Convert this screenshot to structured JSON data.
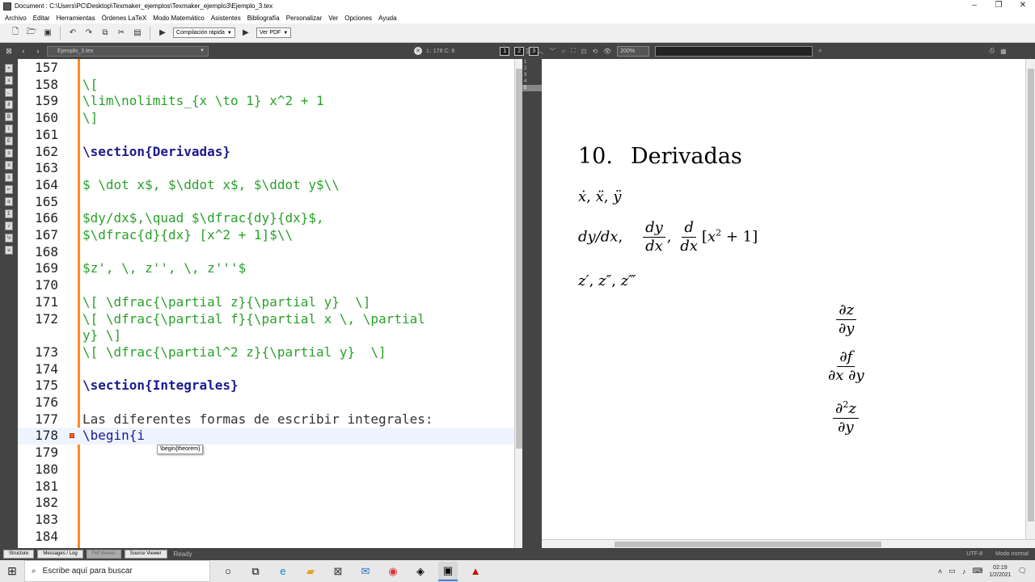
{
  "window": {
    "title": "Document : C:\\Users\\PC\\Desktop\\Texmaker_ejemplos\\Texmaker_ejemplo3\\Ejemplo_3.tex"
  },
  "menu": [
    "Archivo",
    "Editar",
    "Herramientas",
    "Órdenes LaTeX",
    "Modo Matemático",
    "Asistentes",
    "Bibliografía",
    "Personalizar",
    "Ver",
    "Opciones",
    "Ayuda"
  ],
  "toolbar": {
    "compile_label": "Compilación rápida",
    "view_label": "Ver PDF"
  },
  "tabbar": {
    "file_name": "Ejemplo_3.tex",
    "position": "L: 178 C: 8",
    "structure_buttons": [
      "1",
      "2",
      "3"
    ],
    "zoom": "200%"
  },
  "editor": {
    "lines": [
      {
        "num": "157",
        "text": "",
        "style": "green"
      },
      {
        "num": "158",
        "text": "\\[",
        "style": "green"
      },
      {
        "num": "159",
        "text": "\\lim\\nolimits_{x \\to 1} x^2 + 1",
        "style": "green"
      },
      {
        "num": "160",
        "text": "\\]",
        "style": "green"
      },
      {
        "num": "161",
        "text": "",
        "style": "green"
      },
      {
        "num": "162",
        "text": "\\section{Derivadas}",
        "style": "blue"
      },
      {
        "num": "163",
        "text": "",
        "style": "green"
      },
      {
        "num": "164",
        "text": "$ \\dot x$, $\\ddot x$, $\\ddot y$\\\\",
        "style": "green"
      },
      {
        "num": "165",
        "text": "",
        "style": "green"
      },
      {
        "num": "166",
        "text": "$dy/dx$,\\quad $\\dfrac{dy}{dx}$,",
        "style": "green"
      },
      {
        "num": "167",
        "text": "$\\dfrac{d}{dx} [x^2 + 1]$\\\\",
        "style": "green"
      },
      {
        "num": "168",
        "text": "",
        "style": "green"
      },
      {
        "num": "169",
        "text": "$z', \\, z'', \\, z'''$",
        "style": "green"
      },
      {
        "num": "170",
        "text": "",
        "style": "green"
      },
      {
        "num": "171",
        "text": "\\[ \\dfrac{\\partial z}{\\partial y}  \\]",
        "style": "green"
      },
      {
        "num": "172",
        "text": "\\[ \\dfrac{\\partial f}{\\partial x \\, \\partial",
        "style": "green"
      },
      {
        "num": "",
        "text": "y} \\]",
        "style": "green"
      },
      {
        "num": "173",
        "text": "\\[ \\dfrac{\\partial^2 z}{\\partial y}  \\]",
        "style": "green"
      },
      {
        "num": "174",
        "text": "",
        "style": "green"
      },
      {
        "num": "175",
        "text": "\\section{Integrales}",
        "style": "blue"
      },
      {
        "num": "176",
        "text": "",
        "style": "green"
      },
      {
        "num": "177",
        "text": "Las diferentes formas de escribir integrales:",
        "style": "dark"
      },
      {
        "num": "178",
        "text": "\\begin{i",
        "style": "kw"
      },
      {
        "num": "179",
        "text": "",
        "style": "green"
      },
      {
        "num": "180",
        "text": "",
        "style": "green"
      },
      {
        "num": "181",
        "text": "",
        "style": "green"
      },
      {
        "num": "182",
        "text": "",
        "style": "green"
      },
      {
        "num": "183",
        "text": "",
        "style": "green"
      },
      {
        "num": "184",
        "text": "",
        "style": "green"
      }
    ],
    "autocomplete": "\\begin{theorem}"
  },
  "pdf": {
    "thumbs": [
      "1",
      "2",
      "3",
      "4",
      "5"
    ],
    "section_number": "10.",
    "section_title": "Derivadas"
  },
  "statusbar": {
    "buttons": [
      "Structure",
      "Messages / Log",
      "Pdf Viewer",
      "Source Viewer"
    ],
    "ready": "Ready",
    "encoding": "UTF-8",
    "mode": "Modo normal"
  },
  "taskbar": {
    "search_placeholder": "Escribe aquí para buscar",
    "time": "02:19",
    "date": "1/2/2021"
  }
}
